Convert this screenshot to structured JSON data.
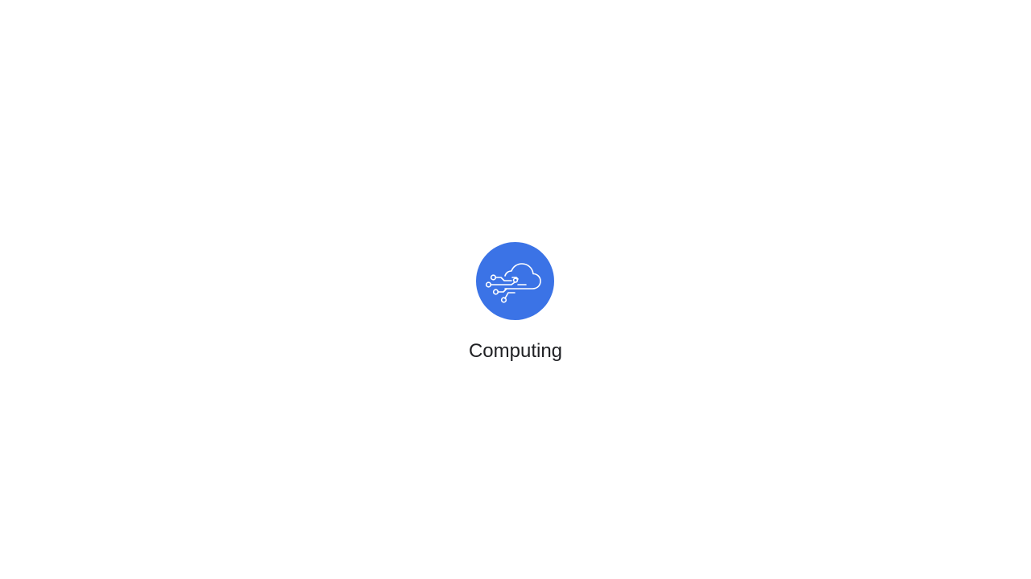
{
  "loader": {
    "icon": "cloud-circuit-icon",
    "label": "Computing"
  },
  "colors": {
    "accent": "#3b73e6",
    "background": "#ffffff",
    "text": "#202124"
  }
}
